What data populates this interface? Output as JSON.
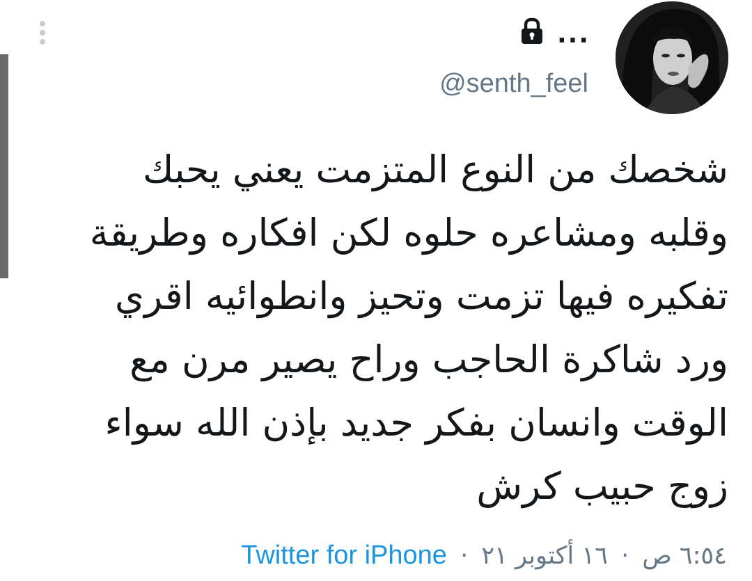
{
  "tweet": {
    "handle": "@senth_feel",
    "protected_icon": "lock-icon",
    "more_icon": "more-horizontal-icon",
    "more_glyph": "...",
    "text_lines": [
      "شخصك من النوع المتزمت يعني يحبك",
      "وقلبه ومشاعره حلوه لكن افكاره وطريقة",
      "تفكيره فيها تزمت وتحيز وانطوائيه اقري",
      "ورد شاكرة الحاجب وراح يصير مرن مع",
      "الوقت وانسان بفكر جديد بإذن الله سواء",
      "زوج حبيب كرش"
    ],
    "time": "٦:٥٤ ص",
    "date": "١٦ أكتوبر ٢١",
    "separator": "·",
    "source": "Twitter for iPhone"
  },
  "colors": {
    "text": "#14171a",
    "muted": "#657786",
    "link": "#1b95e0",
    "scrollbar": "#6b6b6b",
    "dots": "#c6ccd3"
  }
}
